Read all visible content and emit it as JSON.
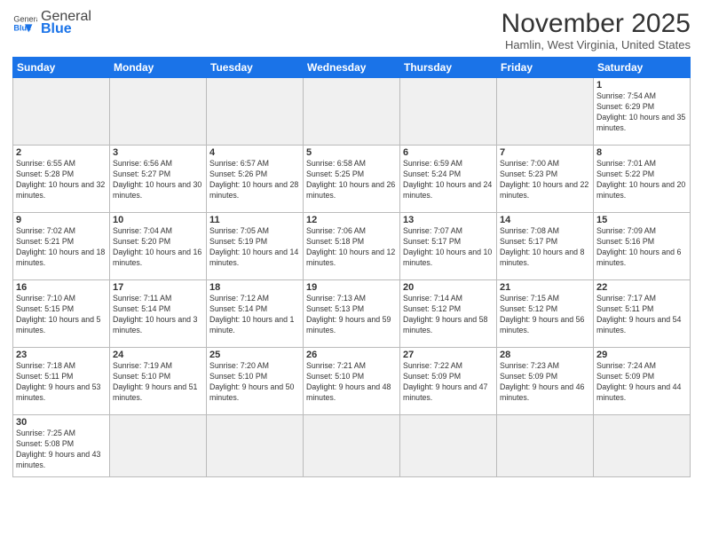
{
  "header": {
    "logo_general": "General",
    "logo_blue": "Blue",
    "title": "November 2025",
    "location": "Hamlin, West Virginia, United States"
  },
  "days_of_week": [
    "Sunday",
    "Monday",
    "Tuesday",
    "Wednesday",
    "Thursday",
    "Friday",
    "Saturday"
  ],
  "weeks": [
    [
      {
        "day": "",
        "info": "",
        "empty": true
      },
      {
        "day": "",
        "info": "",
        "empty": true
      },
      {
        "day": "",
        "info": "",
        "empty": true
      },
      {
        "day": "",
        "info": "",
        "empty": true
      },
      {
        "day": "",
        "info": "",
        "empty": true
      },
      {
        "day": "",
        "info": "",
        "empty": true
      },
      {
        "day": "1",
        "info": "Sunrise: 7:54 AM\nSunset: 6:29 PM\nDaylight: 10 hours and 35 minutes."
      }
    ],
    [
      {
        "day": "2",
        "info": "Sunrise: 6:55 AM\nSunset: 5:28 PM\nDaylight: 10 hours and 32 minutes."
      },
      {
        "day": "3",
        "info": "Sunrise: 6:56 AM\nSunset: 5:27 PM\nDaylight: 10 hours and 30 minutes."
      },
      {
        "day": "4",
        "info": "Sunrise: 6:57 AM\nSunset: 5:26 PM\nDaylight: 10 hours and 28 minutes."
      },
      {
        "day": "5",
        "info": "Sunrise: 6:58 AM\nSunset: 5:25 PM\nDaylight: 10 hours and 26 minutes."
      },
      {
        "day": "6",
        "info": "Sunrise: 6:59 AM\nSunset: 5:24 PM\nDaylight: 10 hours and 24 minutes."
      },
      {
        "day": "7",
        "info": "Sunrise: 7:00 AM\nSunset: 5:23 PM\nDaylight: 10 hours and 22 minutes."
      },
      {
        "day": "8",
        "info": "Sunrise: 7:01 AM\nSunset: 5:22 PM\nDaylight: 10 hours and 20 minutes."
      }
    ],
    [
      {
        "day": "9",
        "info": "Sunrise: 7:02 AM\nSunset: 5:21 PM\nDaylight: 10 hours and 18 minutes."
      },
      {
        "day": "10",
        "info": "Sunrise: 7:04 AM\nSunset: 5:20 PM\nDaylight: 10 hours and 16 minutes."
      },
      {
        "day": "11",
        "info": "Sunrise: 7:05 AM\nSunset: 5:19 PM\nDaylight: 10 hours and 14 minutes."
      },
      {
        "day": "12",
        "info": "Sunrise: 7:06 AM\nSunset: 5:18 PM\nDaylight: 10 hours and 12 minutes."
      },
      {
        "day": "13",
        "info": "Sunrise: 7:07 AM\nSunset: 5:17 PM\nDaylight: 10 hours and 10 minutes."
      },
      {
        "day": "14",
        "info": "Sunrise: 7:08 AM\nSunset: 5:17 PM\nDaylight: 10 hours and 8 minutes."
      },
      {
        "day": "15",
        "info": "Sunrise: 7:09 AM\nSunset: 5:16 PM\nDaylight: 10 hours and 6 minutes."
      }
    ],
    [
      {
        "day": "16",
        "info": "Sunrise: 7:10 AM\nSunset: 5:15 PM\nDaylight: 10 hours and 5 minutes."
      },
      {
        "day": "17",
        "info": "Sunrise: 7:11 AM\nSunset: 5:14 PM\nDaylight: 10 hours and 3 minutes."
      },
      {
        "day": "18",
        "info": "Sunrise: 7:12 AM\nSunset: 5:14 PM\nDaylight: 10 hours and 1 minute."
      },
      {
        "day": "19",
        "info": "Sunrise: 7:13 AM\nSunset: 5:13 PM\nDaylight: 9 hours and 59 minutes."
      },
      {
        "day": "20",
        "info": "Sunrise: 7:14 AM\nSunset: 5:12 PM\nDaylight: 9 hours and 58 minutes."
      },
      {
        "day": "21",
        "info": "Sunrise: 7:15 AM\nSunset: 5:12 PM\nDaylight: 9 hours and 56 minutes."
      },
      {
        "day": "22",
        "info": "Sunrise: 7:17 AM\nSunset: 5:11 PM\nDaylight: 9 hours and 54 minutes."
      }
    ],
    [
      {
        "day": "23",
        "info": "Sunrise: 7:18 AM\nSunset: 5:11 PM\nDaylight: 9 hours and 53 minutes."
      },
      {
        "day": "24",
        "info": "Sunrise: 7:19 AM\nSunset: 5:10 PM\nDaylight: 9 hours and 51 minutes."
      },
      {
        "day": "25",
        "info": "Sunrise: 7:20 AM\nSunset: 5:10 PM\nDaylight: 9 hours and 50 minutes."
      },
      {
        "day": "26",
        "info": "Sunrise: 7:21 AM\nSunset: 5:10 PM\nDaylight: 9 hours and 48 minutes."
      },
      {
        "day": "27",
        "info": "Sunrise: 7:22 AM\nSunset: 5:09 PM\nDaylight: 9 hours and 47 minutes."
      },
      {
        "day": "28",
        "info": "Sunrise: 7:23 AM\nSunset: 5:09 PM\nDaylight: 9 hours and 46 minutes."
      },
      {
        "day": "29",
        "info": "Sunrise: 7:24 AM\nSunset: 5:09 PM\nDaylight: 9 hours and 44 minutes."
      }
    ],
    [
      {
        "day": "30",
        "info": "Sunrise: 7:25 AM\nSunset: 5:08 PM\nDaylight: 9 hours and 43 minutes."
      },
      {
        "day": "",
        "info": "",
        "empty": true
      },
      {
        "day": "",
        "info": "",
        "empty": true
      },
      {
        "day": "",
        "info": "",
        "empty": true
      },
      {
        "day": "",
        "info": "",
        "empty": true
      },
      {
        "day": "",
        "info": "",
        "empty": true
      },
      {
        "day": "",
        "info": "",
        "empty": true
      }
    ]
  ]
}
